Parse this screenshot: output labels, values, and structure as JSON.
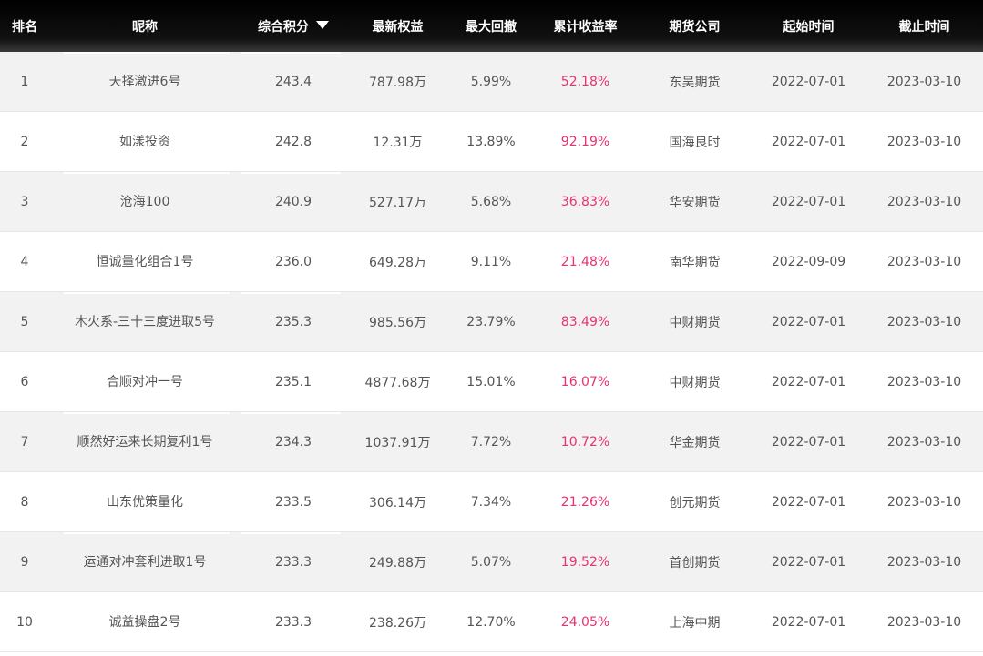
{
  "table": {
    "headers": {
      "rank": "排名",
      "name": "昵称",
      "score": "综合积分",
      "equity": "最新权益",
      "drawdown": "最大回撤",
      "return": "累计收益率",
      "broker": "期货公司",
      "start": "起始时间",
      "end": "截止时间"
    },
    "sort_icon": "sort-down-icon",
    "accent_color": "#e8336d",
    "rows": [
      {
        "rank": "1",
        "name": "天择激进6号",
        "score": "243.4",
        "equity": "787.98万",
        "drawdown": "5.99%",
        "return": "52.18%",
        "broker": "东吴期货",
        "start": "2022-07-01",
        "end": "2023-03-10"
      },
      {
        "rank": "2",
        "name": "如漾投资",
        "score": "242.8",
        "equity": "12.31万",
        "drawdown": "13.89%",
        "return": "92.19%",
        "broker": "国海良时",
        "start": "2022-07-01",
        "end": "2023-03-10"
      },
      {
        "rank": "3",
        "name": "沧海100",
        "score": "240.9",
        "equity": "527.17万",
        "drawdown": "5.68%",
        "return": "36.83%",
        "broker": "华安期货",
        "start": "2022-07-01",
        "end": "2023-03-10"
      },
      {
        "rank": "4",
        "name": "恒诚量化组合1号",
        "score": "236.0",
        "equity": "649.28万",
        "drawdown": "9.11%",
        "return": "21.48%",
        "broker": "南华期货",
        "start": "2022-09-09",
        "end": "2023-03-10"
      },
      {
        "rank": "5",
        "name": "木火系-三十三度进取5号",
        "score": "235.3",
        "equity": "985.56万",
        "drawdown": "23.79%",
        "return": "83.49%",
        "broker": "中财期货",
        "start": "2022-07-01",
        "end": "2023-03-10"
      },
      {
        "rank": "6",
        "name": "合顺对冲一号",
        "score": "235.1",
        "equity": "4877.68万",
        "drawdown": "15.01%",
        "return": "16.07%",
        "broker": "中财期货",
        "start": "2022-07-01",
        "end": "2023-03-10"
      },
      {
        "rank": "7",
        "name": "顺然好运来长期复利1号",
        "score": "234.3",
        "equity": "1037.91万",
        "drawdown": "7.72%",
        "return": "10.72%",
        "broker": "华金期货",
        "start": "2022-07-01",
        "end": "2023-03-10"
      },
      {
        "rank": "8",
        "name": "山东优策量化",
        "score": "233.5",
        "equity": "306.14万",
        "drawdown": "7.34%",
        "return": "21.26%",
        "broker": "创元期货",
        "start": "2022-07-01",
        "end": "2023-03-10"
      },
      {
        "rank": "9",
        "name": "运通对冲套利进取1号",
        "score": "233.3",
        "equity": "249.88万",
        "drawdown": "5.07%",
        "return": "19.52%",
        "broker": "首创期货",
        "start": "2022-07-01",
        "end": "2023-03-10"
      },
      {
        "rank": "10",
        "name": "诚益操盘2号",
        "score": "233.3",
        "equity": "238.26万",
        "drawdown": "12.70%",
        "return": "24.05%",
        "broker": "上海中期",
        "start": "2022-07-01",
        "end": "2023-03-10"
      }
    ]
  }
}
